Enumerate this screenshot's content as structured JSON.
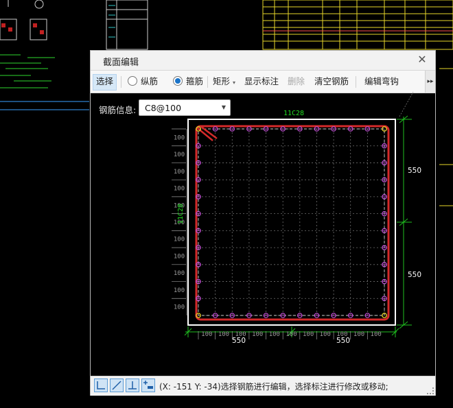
{
  "dialog": {
    "title": "截面编辑",
    "close_glyph": "✕"
  },
  "toolbar": {
    "select": "选择",
    "longitudinal": "纵筋",
    "stirrup": "箍筋",
    "shape": "矩形",
    "show_annotation": "显示标注",
    "delete": "删除",
    "clear_rebar": "清空钢筋",
    "edit_hook": "编辑弯钩",
    "more_glyph": "▸▸"
  },
  "rebar_info": {
    "label": "钢筋信息:",
    "value": "C8@100"
  },
  "section": {
    "top_label": "11C28",
    "left_label": "11C28",
    "right_dims": [
      "550",
      "550"
    ],
    "bottom_dims": [
      "550",
      "550"
    ],
    "spacing_label": "100",
    "bars_per_side": 12,
    "accent_stirrup": "#d42a2a",
    "accent_bar": "#c34fd6",
    "accent_dim": "#1fbf1f",
    "accent_label": "#22dd22"
  },
  "statusbar": {
    "text": "(X: -151 Y: -34)选择钢筋进行编辑，选择标注进行修改或移动;"
  }
}
